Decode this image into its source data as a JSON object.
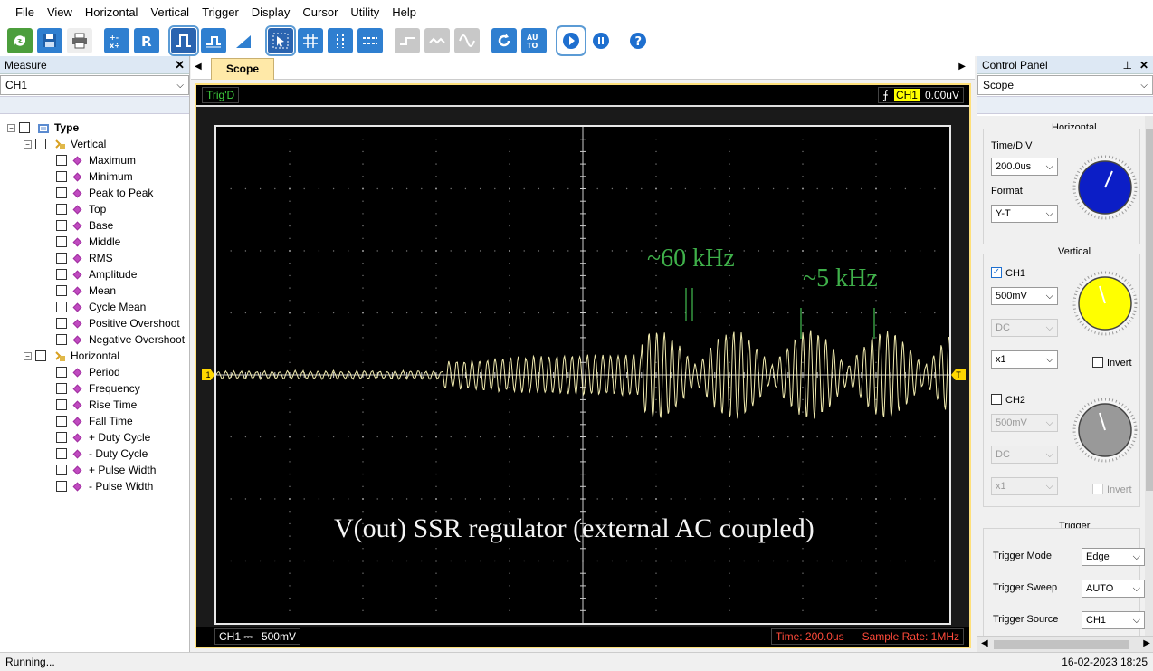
{
  "menu": [
    "File",
    "View",
    "Horizontal",
    "Vertical",
    "Trigger",
    "Display",
    "Cursor",
    "Utility",
    "Help"
  ],
  "toolbar_icons": [
    "refresh-icon",
    "save-icon",
    "print-icon",
    "math-icon",
    "reference-icon",
    "pulse-icon",
    "step-icon",
    "ramp-icon",
    "cursor-select-icon",
    "grid-icon",
    "vertical-cursor-icon",
    "horizontal-cursor-icon",
    "line-icon",
    "wave-icon",
    "sine-icon",
    "rotate-icon",
    "auto-icon",
    "run-icon",
    "pause-icon",
    "help-icon"
  ],
  "measure": {
    "title": "Measure",
    "channel": "CH1",
    "root": "Type",
    "vertical_label": "Vertical",
    "vertical_items": [
      "Maximum",
      "Minimum",
      "Peak to Peak",
      "Top",
      "Base",
      "Middle",
      "RMS",
      "Amplitude",
      "Mean",
      "Cycle Mean",
      "Positive Overshoot",
      "Negative Overshoot"
    ],
    "horizontal_label": "Horizontal",
    "horizontal_items": [
      "Period",
      "Frequency",
      "Rise Time",
      "Fall Time",
      "+ Duty Cycle",
      "- Duty Cycle",
      "+ Pulse Width",
      "- Pulse Width"
    ]
  },
  "scope": {
    "tab": "Scope",
    "trig_status": "Trig'D",
    "trig_channel": "CH1",
    "trig_level": "0.00uV",
    "ch_marker": "1",
    "trig_marker": "T",
    "ch_info_label": "CH1",
    "ch_info_coupling": "⎓",
    "ch_info_scale": "500mV",
    "time": "Time: 200.0us",
    "sample_rate": "Sample Rate: 1MHz",
    "annotation_60k": "~60 kHz",
    "annotation_5k": "~5 kHz",
    "caption": "V(out) SSR regulator (external AC coupled)"
  },
  "control": {
    "title": "Control Panel",
    "mode": "Scope",
    "horizontal": {
      "title": "Horizontal",
      "time_div_label": "Time/DIV",
      "time_div": "200.0us",
      "format_label": "Format",
      "format": "Y-T"
    },
    "vertical": {
      "title": "Vertical",
      "ch1": "CH1",
      "ch1_scale": "500mV",
      "ch1_coupling": "DC",
      "ch1_probe": "x1",
      "invert": "Invert",
      "ch2": "CH2",
      "ch2_scale": "500mV",
      "ch2_coupling": "DC",
      "ch2_probe": "x1",
      "invert2": "Invert"
    },
    "trigger": {
      "title": "Trigger",
      "mode_label": "Trigger Mode",
      "mode": "Edge",
      "sweep_label": "Trigger Sweep",
      "sweep": "AUTO",
      "source_label": "Trigger Source",
      "source": "CH1"
    }
  },
  "status": {
    "left": "Running...",
    "right": "16-02-2023  18:25"
  },
  "colors": {
    "trace": "#f2ecb0",
    "annotation": "#3fb04a",
    "trigd": "#3fd03f",
    "time_info": "#ff4a3a"
  }
}
